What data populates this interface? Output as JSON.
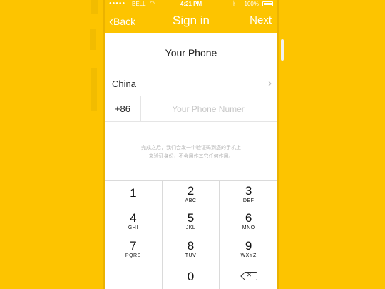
{
  "status_bar": {
    "signal": "●●●●●",
    "carrier": "BELL",
    "time": "4:21 PM",
    "battery_percent": "100%"
  },
  "navbar": {
    "back_label": "Back",
    "title": "Sign in",
    "next_label": "Next"
  },
  "heading": "Your Phone",
  "country": {
    "label": "China"
  },
  "phone": {
    "code": "+86",
    "placeholder": "Your Phone Numer",
    "value": ""
  },
  "note": {
    "line1": "完成之后，我们会发一个验证码到您的手机上",
    "line2": "来验证身份，不会用作其它任何作用。"
  },
  "keypad": [
    {
      "num": "1",
      "letters": ""
    },
    {
      "num": "2",
      "letters": "ABC"
    },
    {
      "num": "3",
      "letters": "DEF"
    },
    {
      "num": "4",
      "letters": "GHI"
    },
    {
      "num": "5",
      "letters": "JKL"
    },
    {
      "num": "6",
      "letters": "MNO"
    },
    {
      "num": "7",
      "letters": "PQRS"
    },
    {
      "num": "8",
      "letters": "TUV"
    },
    {
      "num": "9",
      "letters": "WXYZ"
    },
    {
      "num": "0",
      "letters": ""
    }
  ],
  "colors": {
    "accent": "#FDC400",
    "background": "#FFFFFF"
  }
}
